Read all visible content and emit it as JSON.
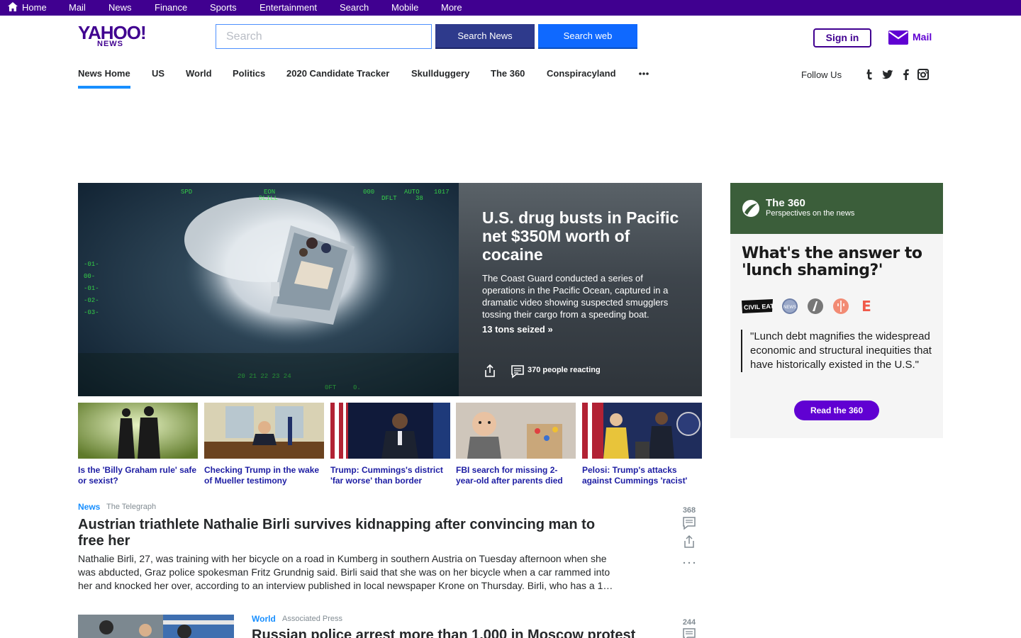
{
  "topbar": {
    "items": [
      "Home",
      "Mail",
      "News",
      "Finance",
      "Sports",
      "Entertainment",
      "Search",
      "Mobile",
      "More"
    ]
  },
  "header": {
    "logo_main": "YAHOO!",
    "logo_sub": "NEWS",
    "search_placeholder": "Search",
    "search_news_label": "Search News",
    "search_web_label": "Search web",
    "signin_label": "Sign in",
    "mail_label": "Mail"
  },
  "nav": {
    "items": [
      "News Home",
      "US",
      "World",
      "Politics",
      "2020 Candidate Tracker",
      "Skullduggery",
      "The 360",
      "Conspiracyland"
    ],
    "follow_label": "Follow Us"
  },
  "hero": {
    "title": "U.S. drug busts in Pacific net $350M worth of cocaine",
    "description": "The Coast Guard conducted a series of operations in the Pacific Ocean, captured in a dramatic video showing suspected smugglers tossing their cargo from a speeding boat.",
    "link": "13 tons seized »",
    "reactions": "370 people reacting"
  },
  "thumbnails": [
    {
      "caption": "Is the 'Billy Graham rule' safe or sexist?"
    },
    {
      "caption": "Checking Trump in the wake of Mueller testimony"
    },
    {
      "caption": "Trump: Cummings's district 'far worse' than border"
    },
    {
      "caption": "FBI search for missing 2-year-old after parents died"
    },
    {
      "caption": "Pelosi: Trump's attacks against Cummings 'racist'"
    }
  ],
  "stream": [
    {
      "category": "News",
      "source": "The Telegraph",
      "title": "Austrian triathlete Nathalie Birli survives kidnapping after convincing man to free her",
      "body": "Nathalie Birli, 27, was training with her bicycle on a road in Kumberg in southern Austria on Tuesday afternoon when she was abducted, Graz police spokesman Fritz Grundnig said. Birli said that she was on her bicycle when a car rammed into her and knocked her over, according to an interview published in local newspaper Krone on Thursday. Birli, who has a 1…",
      "comments": "368"
    },
    {
      "category": "World",
      "source": "Associated Press",
      "title": "Russian police arrest more than 1,000 in Moscow protest",
      "comments": "244"
    }
  ],
  "right_panel": {
    "brand": "The 360",
    "tagline": "Perspectives on the news",
    "question": "What's the answer to 'lunch shaming?'",
    "quote": "\"Lunch debt magnifies the widespread economic and structural inequities that have historically existed in the U.S.\"",
    "button": "Read the 360",
    "source_logos": [
      "civil-eats-logo",
      "abc-news-logo",
      "atlantic-logo",
      "eater-logo",
      "e-logo"
    ]
  },
  "colors": {
    "brand_purple": "#400090",
    "accent_blue": "#188fff",
    "link_navy": "#1d1da3",
    "button_purple": "#6001d2"
  }
}
